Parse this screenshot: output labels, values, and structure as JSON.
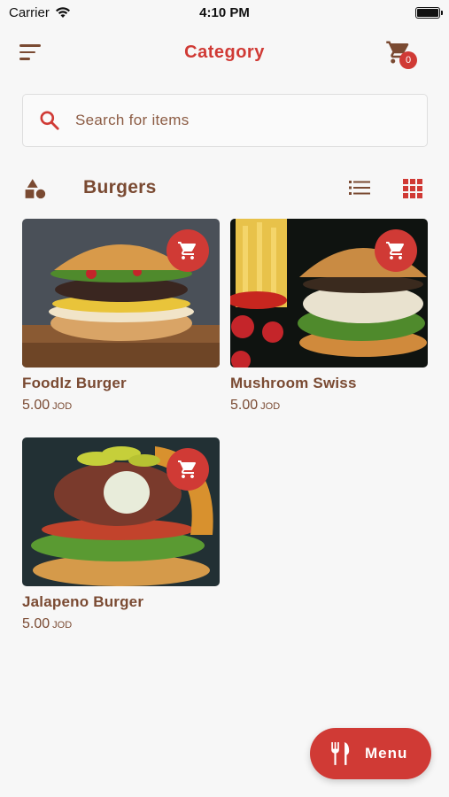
{
  "status_bar": {
    "carrier": "Carrier",
    "time": "4:10 PM"
  },
  "header": {
    "title": "Category",
    "cart_count": "0"
  },
  "search": {
    "placeholder": "Search for items"
  },
  "section": {
    "title": "Burgers"
  },
  "items": [
    {
      "name": "Foodlz Burger",
      "price": "5.00",
      "currency": "JOD"
    },
    {
      "name": "Mushroom Swiss",
      "price": "5.00",
      "currency": "JOD"
    },
    {
      "name": "Jalapeno Burger",
      "price": "5.00",
      "currency": "JOD"
    }
  ],
  "menu_button": {
    "label": "Menu"
  },
  "icons": [
    "wifi-icon",
    "battery-icon",
    "hamburger-menu-icon",
    "cart-icon",
    "search-icon",
    "shapes-icon",
    "list-view-icon",
    "grid-view-icon",
    "add-to-cart-icon",
    "fork-knife-icon"
  ],
  "colors": {
    "accent": "#d03a35",
    "text_brown": "#7a4a32",
    "background": "#f7f7f7"
  }
}
